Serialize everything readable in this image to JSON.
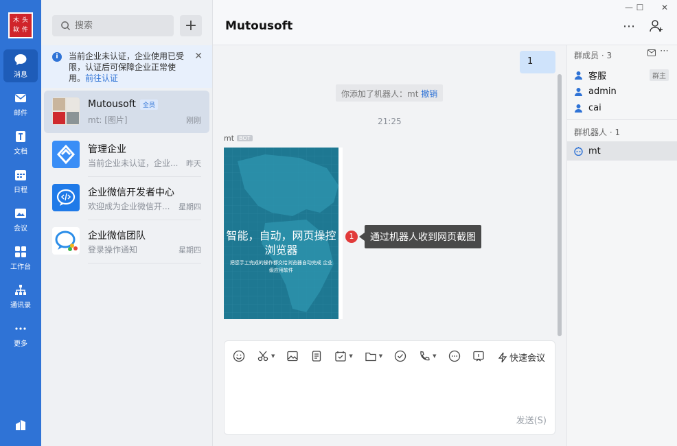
{
  "nav": {
    "logo_chars": [
      "木",
      "头",
      "软",
      "件"
    ],
    "items": [
      {
        "label": "消息",
        "icon": "message-icon"
      },
      {
        "label": "邮件",
        "icon": "mail-icon"
      },
      {
        "label": "文档",
        "icon": "doc-icon"
      },
      {
        "label": "日程",
        "icon": "calendar-icon"
      },
      {
        "label": "会议",
        "icon": "meeting-icon"
      },
      {
        "label": "工作台",
        "icon": "workbench-icon"
      },
      {
        "label": "通讯录",
        "icon": "contacts-icon"
      },
      {
        "label": "更多",
        "icon": "more-icon"
      }
    ]
  },
  "search": {
    "placeholder": "搜索"
  },
  "notice": {
    "text": "当前企业未认证，企业使用已受限，认证后可保障企业正常使用。",
    "link": "前往认证"
  },
  "conversations": [
    {
      "name": "Mutousoft",
      "badge": "全员",
      "preview": "mt: [图片]",
      "time": "刚刚"
    },
    {
      "name": "管理企业",
      "badge": "",
      "preview": "当前企业未认证，企业...",
      "time": "昨天"
    },
    {
      "name": "企业微信开发者中心",
      "badge": "",
      "preview": "欢迎成为企业微信开...",
      "time": "星期四"
    },
    {
      "name": "企业微信团队",
      "badge": "",
      "preview": "登录操作通知",
      "time": "星期四"
    }
  ],
  "chat": {
    "title": "Mutousoft",
    "my_message": "1",
    "system_message": "你添加了机器人：mt",
    "system_link": "撤销",
    "timestamp": "21:25",
    "sender": "mt",
    "sender_tag": "BOT",
    "image_title": "智能，自动，网页操控浏览器",
    "image_subtitle": "把您手工完成的操作都交给浏览器自动完成 企业级应用软件",
    "callout_number": "1",
    "callout_text": "通过机器人收到网页截图"
  },
  "composer": {
    "quick_meeting": "快速会议",
    "send": "发送(S)"
  },
  "members": {
    "header": "群成员 · 3",
    "list": [
      {
        "name": "客服",
        "tag": "群主"
      },
      {
        "name": "admin",
        "tag": ""
      },
      {
        "name": "cai",
        "tag": ""
      }
    ],
    "bots_header": "群机器人 · 1",
    "bots": [
      {
        "name": "mt"
      }
    ]
  }
}
